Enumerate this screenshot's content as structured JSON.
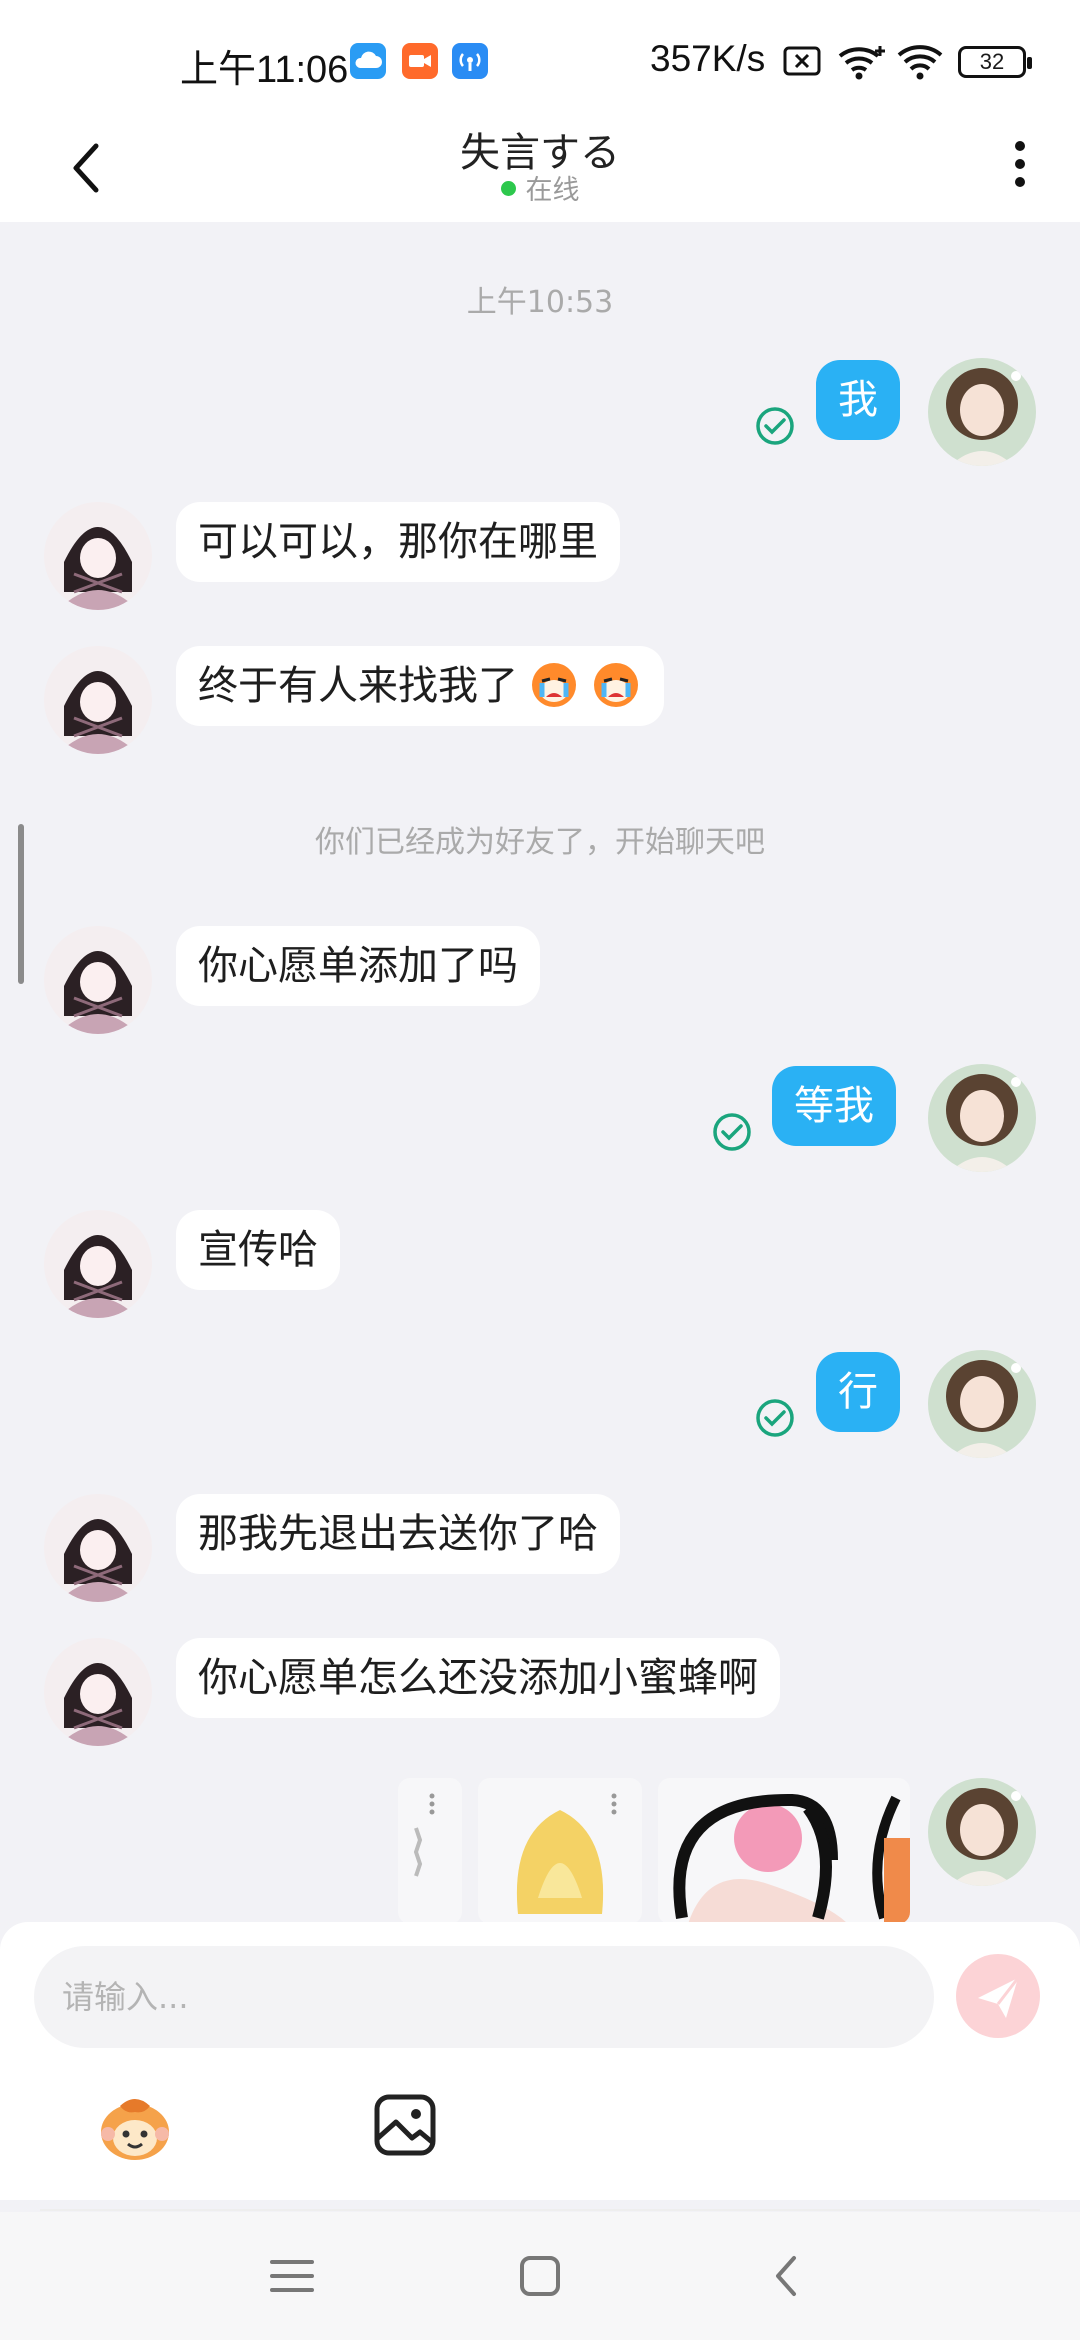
{
  "status_bar": {
    "time": "上午11:06",
    "net_speed": "357K/s",
    "battery": "32",
    "app_icons": [
      "cloud-icon",
      "video-icon",
      "hotspot-icon"
    ],
    "colors": {
      "cloud": "#2a9cf4",
      "video": "#ff6a2b",
      "hotspot": "#2a8cf4"
    }
  },
  "header": {
    "title": "失言する",
    "status": "在线",
    "status_color": "#2dc84d"
  },
  "chat": {
    "timestamp": "上午10:53",
    "system_message": "你们已经成为好友了，开始聊天吧",
    "messages": [
      {
        "side": "out",
        "text": "我"
      },
      {
        "side": "in",
        "text": "可以可以，那你在哪里"
      },
      {
        "side": "in",
        "text": "终于有人来找我了"
      },
      {
        "side": "in",
        "text": "你心愿单添加了吗"
      },
      {
        "side": "out",
        "text": "等我"
      },
      {
        "side": "in",
        "text": "宣传哈"
      },
      {
        "side": "out",
        "text": "行"
      },
      {
        "side": "in",
        "text": "那我先退出去送你了哈"
      },
      {
        "side": "in",
        "text": "你心愿单怎么还没添加小蜜蜂啊"
      }
    ],
    "emoji_in_message": [
      "crying-face-emoji",
      "crying-face-emoji"
    ],
    "colors": {
      "out_bubble": "#2ab1f4",
      "in_bubble": "#ffffff",
      "check": "#1aa57d"
    }
  },
  "composer": {
    "placeholder": "请输入...",
    "tools": [
      "emoji-icon",
      "image-icon"
    ]
  },
  "nav_bar": {
    "buttons": [
      "menu-icon",
      "home-icon",
      "back-icon"
    ]
  }
}
